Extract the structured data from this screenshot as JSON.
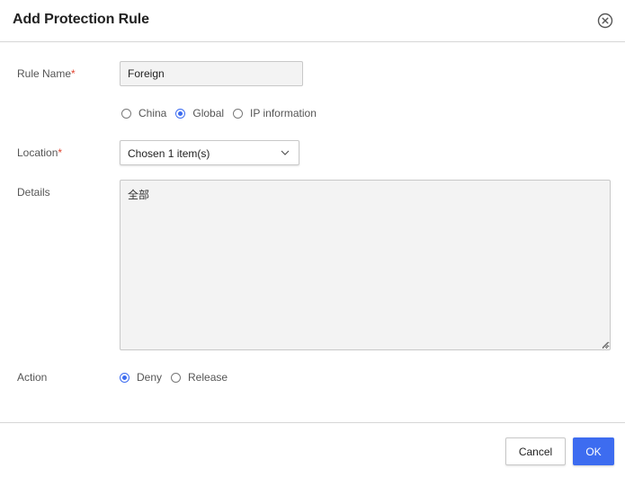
{
  "dialog": {
    "title": "Add Protection Rule",
    "close_icon": "close-circle-icon"
  },
  "form": {
    "rule_name": {
      "label": "Rule Name",
      "required_mark": "*",
      "value": "Foreign"
    },
    "scope": {
      "options": [
        {
          "label": "China",
          "checked": false
        },
        {
          "label": "Global",
          "checked": true
        },
        {
          "label": "IP information",
          "checked": false
        }
      ]
    },
    "location": {
      "label": "Location",
      "required_mark": "*",
      "value": "Chosen 1 item(s)",
      "chevron_icon": "chevron-down-icon"
    },
    "details": {
      "label": "Details",
      "value": "全部"
    },
    "action": {
      "label": "Action",
      "options": [
        {
          "label": "Deny",
          "checked": true
        },
        {
          "label": "Release",
          "checked": false
        }
      ]
    }
  },
  "footer": {
    "cancel_label": "Cancel",
    "ok_label": "OK"
  },
  "colors": {
    "accent": "#3d6cf0",
    "required": "#e0432f"
  }
}
